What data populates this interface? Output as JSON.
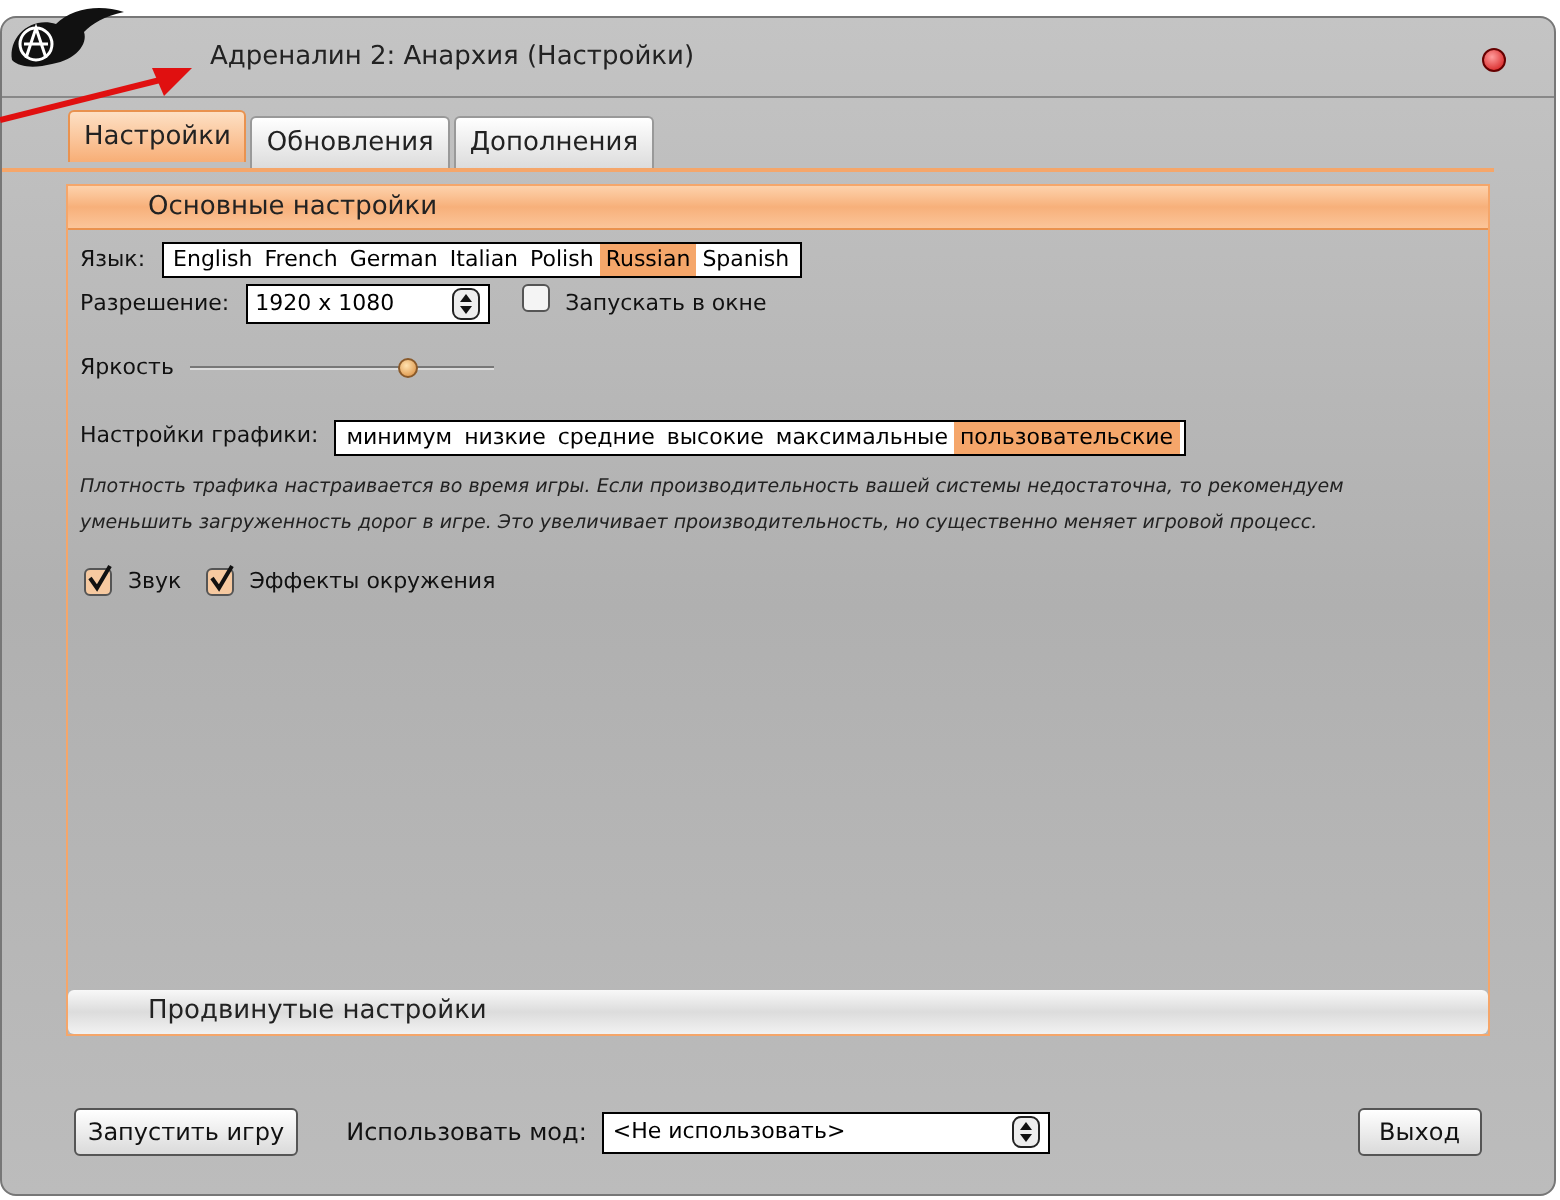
{
  "window": {
    "title": "Адреналин 2: Анархия (Настройки)"
  },
  "tabs": [
    {
      "label": "Настройки",
      "selected": true
    },
    {
      "label": "Обновления",
      "selected": false
    },
    {
      "label": "Дополнения",
      "selected": false
    }
  ],
  "basic_section": {
    "title": "Основные настройки",
    "expanded": true
  },
  "language": {
    "label": "Язык:",
    "options": [
      {
        "label": "English",
        "selected": false
      },
      {
        "label": "French",
        "selected": false
      },
      {
        "label": "German",
        "selected": false
      },
      {
        "label": "Italian",
        "selected": false
      },
      {
        "label": "Polish",
        "selected": false
      },
      {
        "label": "Russian",
        "selected": true
      },
      {
        "label": "Spanish",
        "selected": false
      }
    ]
  },
  "resolution": {
    "label": "Разрешение:",
    "value": "1920 x 1080"
  },
  "windowed": {
    "label": "Запускать в окне",
    "checked": false
  },
  "brightness": {
    "label": "Яркость",
    "level": 0.72
  },
  "graphics": {
    "label": "Настройки графики:",
    "options": [
      {
        "label": "минимум",
        "selected": false
      },
      {
        "label": "низкие",
        "selected": false
      },
      {
        "label": "средние",
        "selected": false
      },
      {
        "label": "высокие",
        "selected": false
      },
      {
        "label": "максимальные",
        "selected": false
      },
      {
        "label": "пользовательские",
        "selected": true
      }
    ]
  },
  "note": [
    "Плотность трафика настраивается во время игры. Если производительность вашей системы недостаточна, то рекомендуем",
    "уменьшить загруженность дорог в игре. Это увеличивает производительность, но существенно меняет игровой процесс."
  ],
  "checkboxes": [
    {
      "label": "Звук",
      "checked": true
    },
    {
      "label": "Эффекты окружения",
      "checked": true
    }
  ],
  "advanced_section": {
    "title": "Продвинутые настройки",
    "expanded": false
  },
  "footer": {
    "launch_button": "Запустить игру",
    "mod_label": "Использовать мод:",
    "mod_value": "<Не использовать>",
    "exit_button": "Выход"
  }
}
